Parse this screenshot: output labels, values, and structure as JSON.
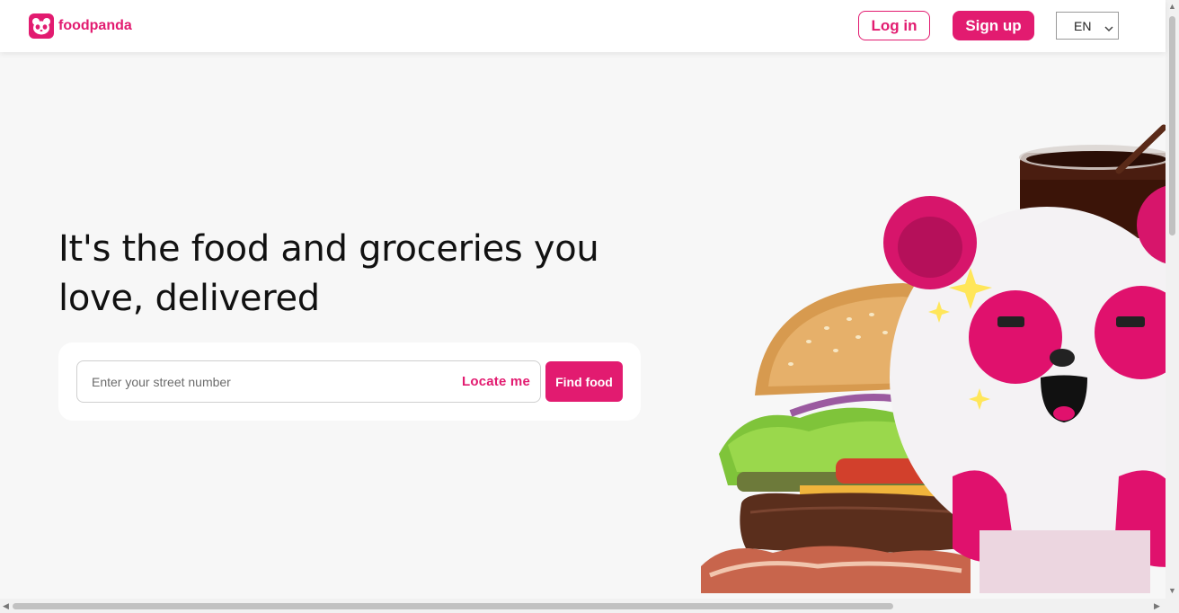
{
  "header": {
    "brand": "foodpanda",
    "login_label": "Log in",
    "signup_label": "Sign up",
    "language": "EN"
  },
  "hero": {
    "headline": "It's the food and groceries you love, delivered"
  },
  "search": {
    "placeholder": "Enter your street number",
    "locate_label": "Locate me",
    "submit_label": "Find food"
  },
  "colors": {
    "brand": "#e21b70",
    "background": "#f7f7f7"
  },
  "icons": [
    "panda-logo-icon",
    "chevron-down-icon",
    "scroll-arrow-up-icon",
    "scroll-arrow-down-icon",
    "scroll-arrow-left-icon",
    "scroll-arrow-right-icon"
  ]
}
